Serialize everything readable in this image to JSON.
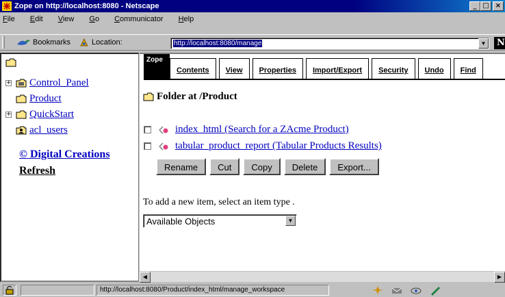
{
  "window": {
    "title": "Zope on http://localhost:8080 - Netscape",
    "buttons": {
      "minimize": "_",
      "maximize": "□",
      "close": "×"
    }
  },
  "menu": [
    {
      "label": "File",
      "key": "F"
    },
    {
      "label": "Edit",
      "key": "E"
    },
    {
      "label": "View",
      "key": "V"
    },
    {
      "label": "Go",
      "key": "G"
    },
    {
      "label": "Communicator",
      "key": "C"
    },
    {
      "label": "Help",
      "key": "H"
    }
  ],
  "location_bar": {
    "bookmarks_label": "Bookmarks",
    "location_label": "Location:",
    "url": "http://localhost:8080/manage",
    "netscape_logo": "N"
  },
  "tree": {
    "items": [
      {
        "label": "Control_Panel",
        "expandable": true,
        "expander": "+",
        "icon": "control-panel-icon"
      },
      {
        "label": "Product",
        "expandable": false,
        "icon": "folder-icon"
      },
      {
        "label": "QuickStart",
        "expandable": true,
        "expander": "+",
        "icon": "folder-icon"
      },
      {
        "label": "acl_users",
        "expandable": false,
        "icon": "user-folder-icon"
      }
    ],
    "digital_creations": "© Digital Creations",
    "refresh": "Refresh"
  },
  "zope_logo": "Zope",
  "tabs": [
    "Contents",
    "View",
    "Properties",
    "Import/Export",
    "Security",
    "Undo",
    "Find"
  ],
  "main": {
    "heading": "Folder at /Product",
    "items": [
      {
        "label": "index_html (Search for a ZAcme Product)",
        "checked": false
      },
      {
        "label": "tabular_product_report (Tabular Products Results)",
        "checked": false
      }
    ],
    "buttons": [
      "Rename",
      "Cut",
      "Copy",
      "Delete",
      "Export..."
    ],
    "add_text": "To add a new item, select an item type .",
    "select_value": "Available Objects"
  },
  "status": {
    "text": "http://localhost:8080/Product/index_html/manage_workspace"
  }
}
